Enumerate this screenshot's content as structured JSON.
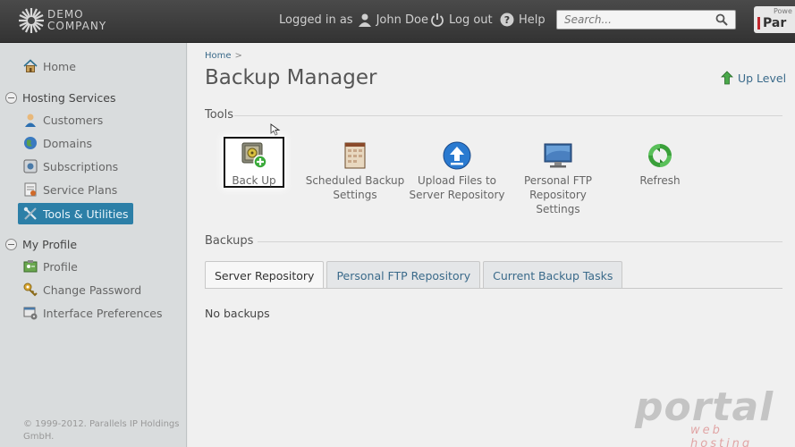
{
  "topbar": {
    "logo_line1": "DEMO",
    "logo_line2": "COMPANY",
    "logged_in_label": "Logged in as",
    "user_name": "John Doe",
    "logout_label": "Log out",
    "help_label": "Help",
    "search_placeholder": "Search...",
    "brand_powered": "Powe",
    "brand_name": "Par"
  },
  "sidebar": {
    "home": "Home",
    "hosting_group": "Hosting Services",
    "hosting_items": [
      "Customers",
      "Domains",
      "Subscriptions",
      "Service Plans",
      "Tools & Utilities"
    ],
    "profile_group": "My Profile",
    "profile_items": [
      "Profile",
      "Change Password",
      "Interface Preferences"
    ],
    "copyright": "© 1999-2012. Parallels IP Holdings GmbH."
  },
  "main": {
    "breadcrumb_home": "Home",
    "breadcrumb_sep": ">",
    "title": "Backup Manager",
    "up_level": "Up Level",
    "tools_title": "Tools",
    "tools": [
      {
        "label": "Back Up"
      },
      {
        "label": "Scheduled Backup Settings"
      },
      {
        "label": "Upload Files to Server Repository"
      },
      {
        "label": "Personal FTP Repository Settings"
      },
      {
        "label": "Refresh"
      }
    ],
    "backups_title": "Backups",
    "tabs": [
      "Server Repository",
      "Personal FTP Repository",
      "Current Backup Tasks"
    ],
    "empty_message": "No backups"
  },
  "watermark": {
    "line1": "portal",
    "line2": "web hosting"
  },
  "colors": {
    "active_nav": "#2c7fa7",
    "link": "#3a6a8a"
  }
}
